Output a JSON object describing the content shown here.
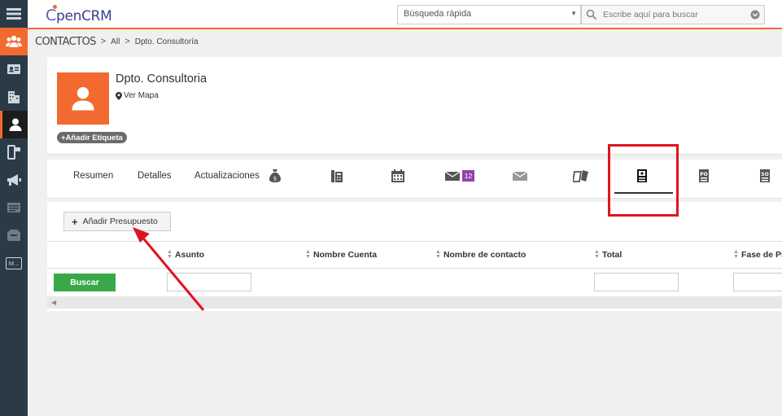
{
  "header": {
    "logo_c": "C",
    "logo_text": "penCRM",
    "quick_search_select": "Búsqueda rápida",
    "search_placeholder": "Escribe aquí para buscar"
  },
  "sidebar": {
    "items": [
      {
        "icon": "menu-icon"
      },
      {
        "icon": "users-group-icon"
      },
      {
        "icon": "address-card-icon"
      },
      {
        "icon": "building-icon"
      },
      {
        "icon": "user-icon"
      },
      {
        "icon": "mobile-icon"
      },
      {
        "icon": "megaphone-icon"
      },
      {
        "icon": "list-icon"
      },
      {
        "icon": "inbox-icon"
      },
      {
        "icon": "module-m-icon",
        "label": "M..."
      }
    ]
  },
  "breadcrumb": {
    "module": "CONTACTOS",
    "sep": ">",
    "filter": "All",
    "record": "Dpto. Consultoría"
  },
  "record": {
    "name": "Dpto. Consultoria",
    "map_link": "Ver Mapa",
    "add_tag": "Añadir Etiqueta"
  },
  "tabs": {
    "resumen": "Resumen",
    "detalles": "Detalles",
    "actualizaciones": "Actualizaciones",
    "email_badge": "12"
  },
  "related": {
    "add_button": "Añadir Presupuesto",
    "search_button": "Buscar",
    "columns": [
      "Asunto",
      "Nombre Cuenta",
      "Nombre de contacto",
      "Total",
      "Fase de Pr"
    ]
  },
  "colors": {
    "accent": "#f26a30",
    "sidebar": "#2b3a47",
    "search_button": "#3aa849",
    "badge": "#8e44ad",
    "annotation": "#e0141e"
  }
}
